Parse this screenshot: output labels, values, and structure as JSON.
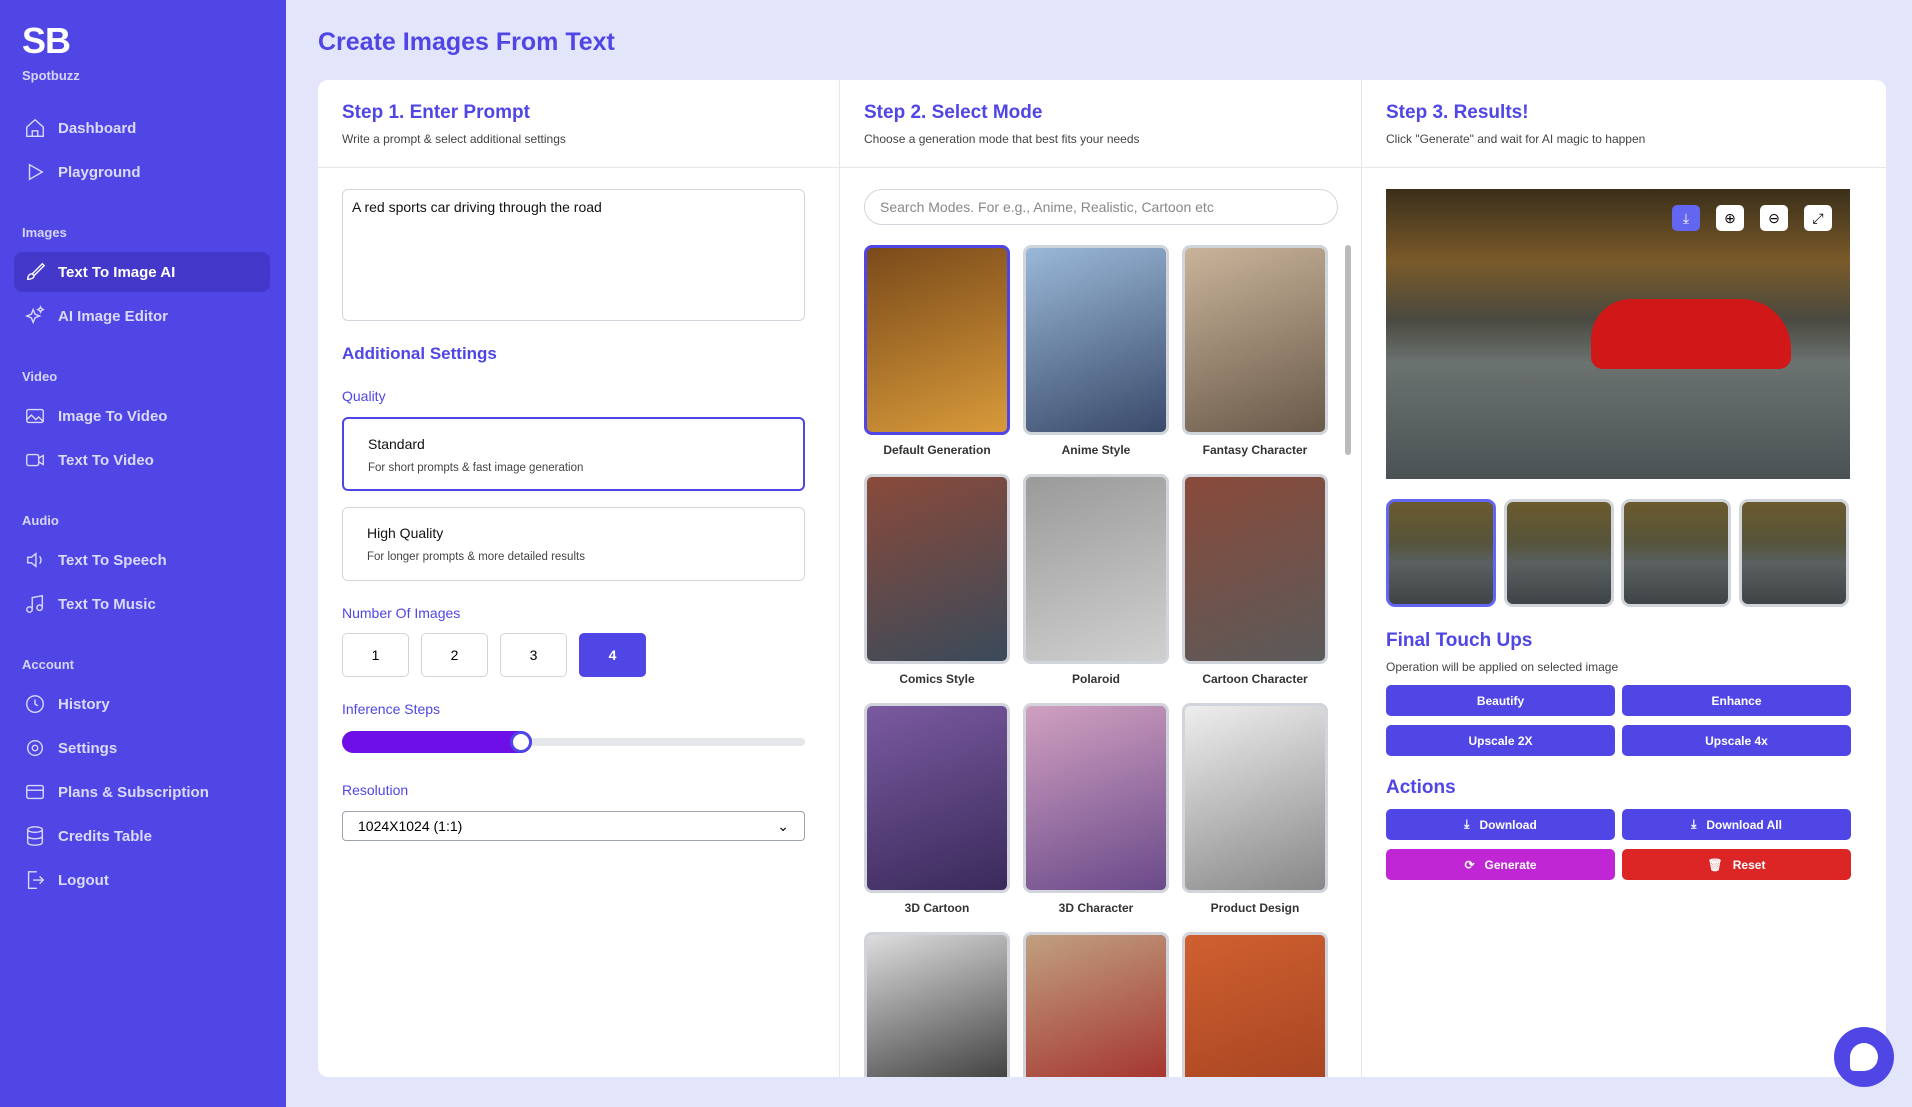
{
  "sidebar": {
    "logo": "SB",
    "brand": "Spotbuzz",
    "items": [
      {
        "label": "Dashboard",
        "icon": "home-icon"
      },
      {
        "label": "Playground",
        "icon": "play-icon"
      },
      {
        "label": "Text To Image AI",
        "icon": "brush-icon",
        "active": true
      },
      {
        "label": "AI Image Editor",
        "icon": "sparkles-icon"
      },
      {
        "label": "Image To Video",
        "icon": "image-icon"
      },
      {
        "label": "Text To Video",
        "icon": "video-icon"
      },
      {
        "label": "Text To Speech",
        "icon": "speaker-icon"
      },
      {
        "label": "Text To Music",
        "icon": "music-icon"
      },
      {
        "label": "History",
        "icon": "clock-icon"
      },
      {
        "label": "Settings",
        "icon": "gear-icon"
      },
      {
        "label": "Plans & Subscription",
        "icon": "card-icon"
      },
      {
        "label": "Credits Table",
        "icon": "database-icon"
      },
      {
        "label": "Logout",
        "icon": "logout-icon"
      }
    ],
    "sections": {
      "images": "Images",
      "video": "Video",
      "audio": "Audio",
      "account": "Account"
    }
  },
  "page_title": "Create Images From Text",
  "step1": {
    "title": "Step 1. Enter Prompt",
    "subtitle": "Write a prompt & select additional settings",
    "prompt": "A red sports car driving through the road",
    "additional": "Additional Settings",
    "quality_label": "Quality",
    "quality": [
      {
        "title": "Standard",
        "desc": "For short prompts & fast image generation",
        "selected": true
      },
      {
        "title": "High Quality",
        "desc": "For longer prompts & more detailed results"
      }
    ],
    "num_label": "Number Of Images",
    "nums": [
      "1",
      "2",
      "3",
      "4"
    ],
    "num_selected": "4",
    "steps_label": "Inference Steps",
    "steps_fraction": 0.41,
    "res_label": "Resolution",
    "resolution": "1024X1024 (1:1)"
  },
  "step2": {
    "title": "Step 2. Select Mode",
    "subtitle": "Choose a generation mode that best fits your needs",
    "search_placeholder": "Search Modes. For e.g., Anime, Realistic, Cartoon etc",
    "modes": [
      "Default Generation",
      "Anime Style",
      "Fantasy Character",
      "Comics Style",
      "Polaroid",
      "Cartoon Character",
      "3D Cartoon",
      "3D Character",
      "Product Design",
      "",
      "",
      ""
    ],
    "selected": "Default Generation"
  },
  "step3": {
    "title": "Step 3. Results!",
    "subtitle": "Click \"Generate\" and wait for AI magic to happen",
    "touch_title": "Final Touch Ups",
    "touch_sub": "Operation will be applied on selected image",
    "touch": [
      "Beautify",
      "Enhance",
      "Upscale 2X",
      "Upscale 4x"
    ],
    "actions_title": "Actions",
    "download": "Download",
    "download_all": "Download All",
    "generate": "Generate",
    "reset": "Reset",
    "colors": {
      "primary": "#4f46e5",
      "generate": "#c026d3",
      "reset": "#dc2626"
    }
  }
}
